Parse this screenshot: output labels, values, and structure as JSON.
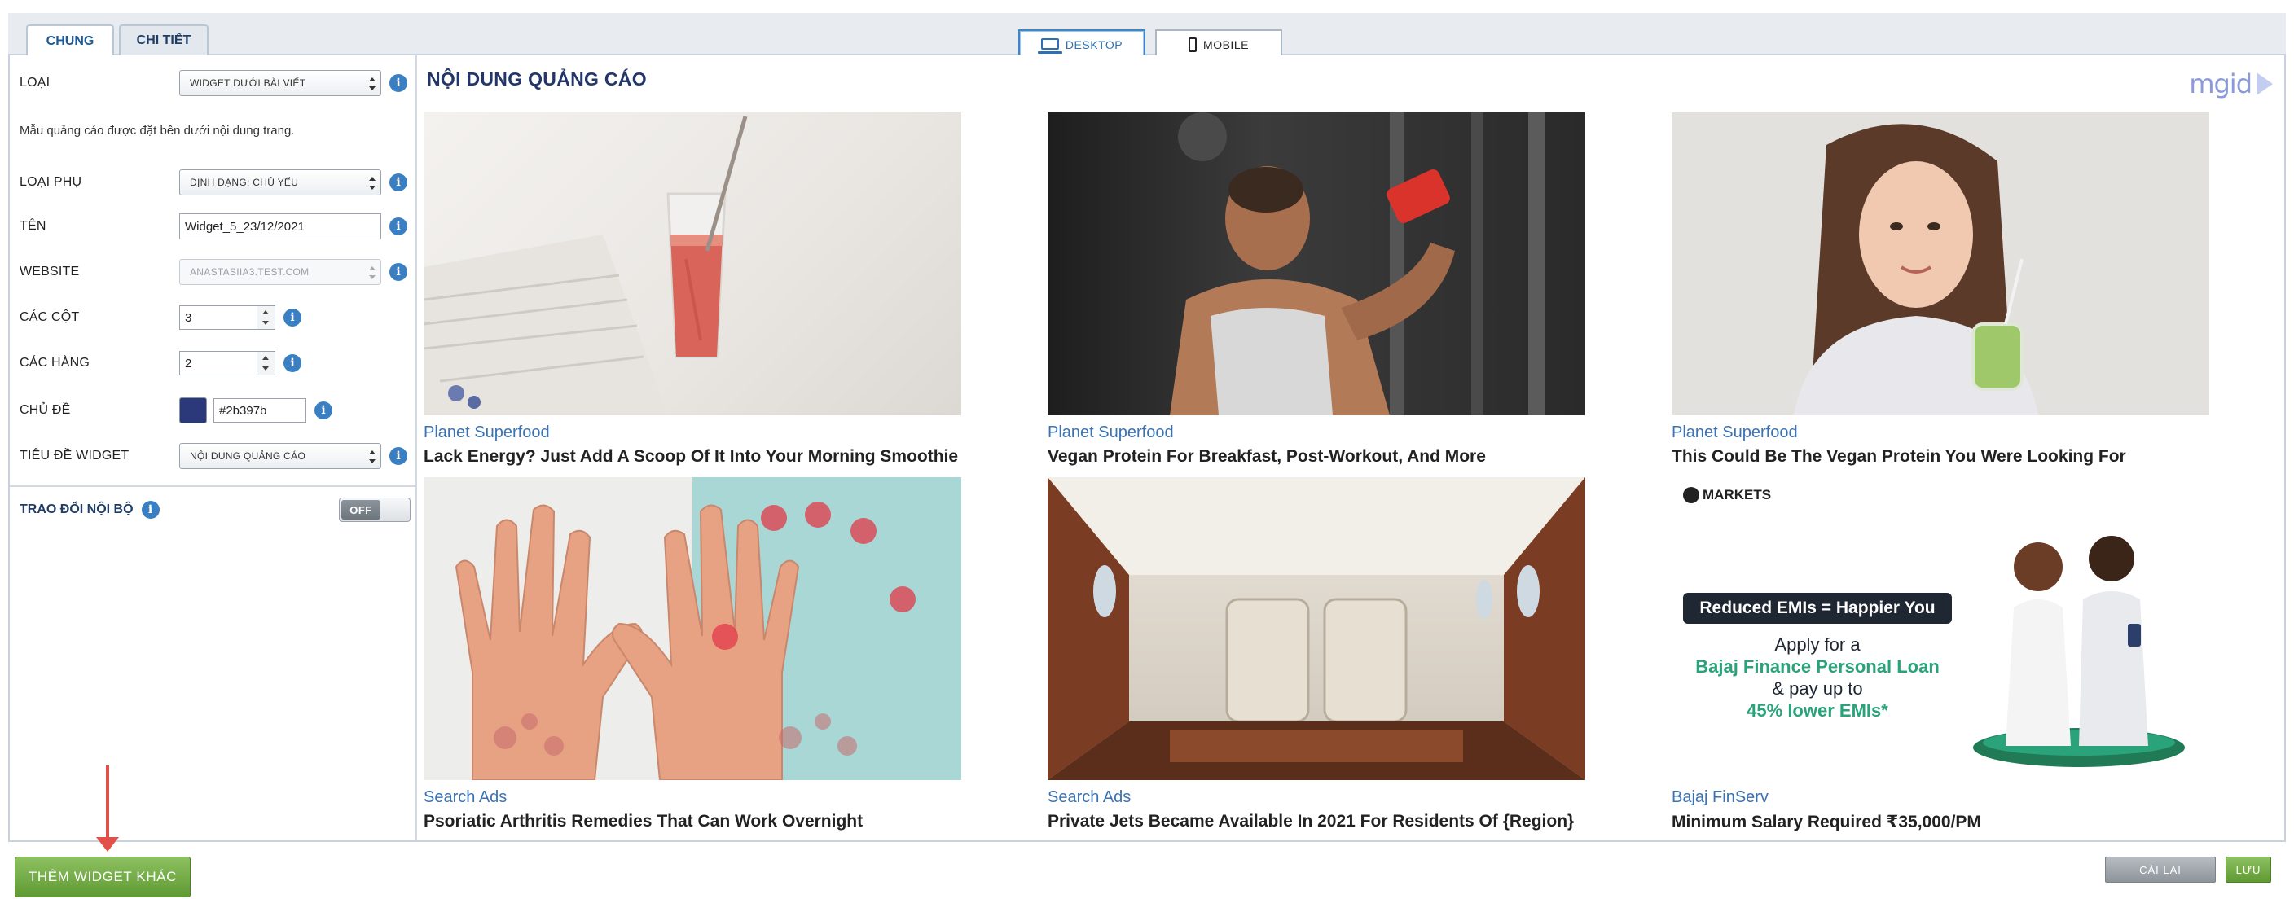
{
  "tabs": [
    {
      "label": "CHUNG",
      "active": true
    },
    {
      "label": "CHI TIẾT",
      "active": false
    }
  ],
  "view_toggle": {
    "desktop": "DESKTOP",
    "mobile": "MOBILE",
    "active": "desktop"
  },
  "settings": {
    "type": {
      "label": "LOẠI",
      "value": "WIDGET DƯỚI BÀI VIẾT"
    },
    "description": "Mẫu quảng cáo được đặt bên dưới nội dung trang.",
    "subtype": {
      "label": "LOẠI PHỤ",
      "value": "ĐỊNH DẠNG: CHỦ YẾU"
    },
    "name": {
      "label": "TÊN",
      "value": "Widget_5_23/12/2021"
    },
    "website": {
      "label": "WEBSITE",
      "value": "ANASTASIIA3.TEST.COM"
    },
    "columns": {
      "label": "CÁC CỘT",
      "value": "3"
    },
    "rows": {
      "label": "CÁC HÀNG",
      "value": "2"
    },
    "theme": {
      "label": "CHỦ ĐỀ",
      "value": "#2b397b"
    },
    "widget_title": {
      "label": "TIÊU ĐỀ WIDGET",
      "value": "NỘI DUNG QUẢNG CÁO"
    },
    "internal_exchange": {
      "label": "TRAO ĐỔI NỘI BỘ",
      "state": "OFF"
    }
  },
  "preview": {
    "title": "NỘI DUNG QUẢNG CÁO",
    "logo": "mgid",
    "cards": [
      {
        "source": "Planet Superfood",
        "title": "Lack Energy? Just Add A Scoop Of It Into Your Morning Smoothie",
        "image": "smoothie-glass"
      },
      {
        "source": "Planet Superfood",
        "title": "Vegan Protein For Breakfast, Post-Workout, And More",
        "image": "athlete-drinking"
      },
      {
        "source": "Planet Superfood",
        "title": "This Could Be The Vegan Protein You Were Looking For",
        "image": "woman-green-smoothie"
      },
      {
        "source": "Search Ads",
        "title": "Psoriatic Arthritis Remedies That Can Work Overnight",
        "image": "hands-illustration"
      },
      {
        "source": "Search Ads",
        "title": "Private Jets Became Available In 2021 For Residents Of {Region}",
        "image": "jet-interior"
      },
      {
        "source": "Bajaj FinServ",
        "title": "Minimum Salary Required ₹35,000/PM",
        "image": "bajaj-loan-ad"
      }
    ],
    "bajaj_ad": {
      "brand": "MARKETS",
      "headline": "Reduced EMIs = Happier You",
      "line1": "Apply for a",
      "line2": "Bajaj Finance Personal Loan",
      "line3": "& pay up to",
      "line4": "45% lower EMIs*"
    }
  },
  "buttons": {
    "add_widget": "THÊM WIDGET KHÁC",
    "reset": "CÀI LẠI",
    "save": "LƯU"
  },
  "colors": {
    "theme": "#2b397b",
    "accent_green": "#6aa63b",
    "link_blue": "#3a73b3"
  }
}
